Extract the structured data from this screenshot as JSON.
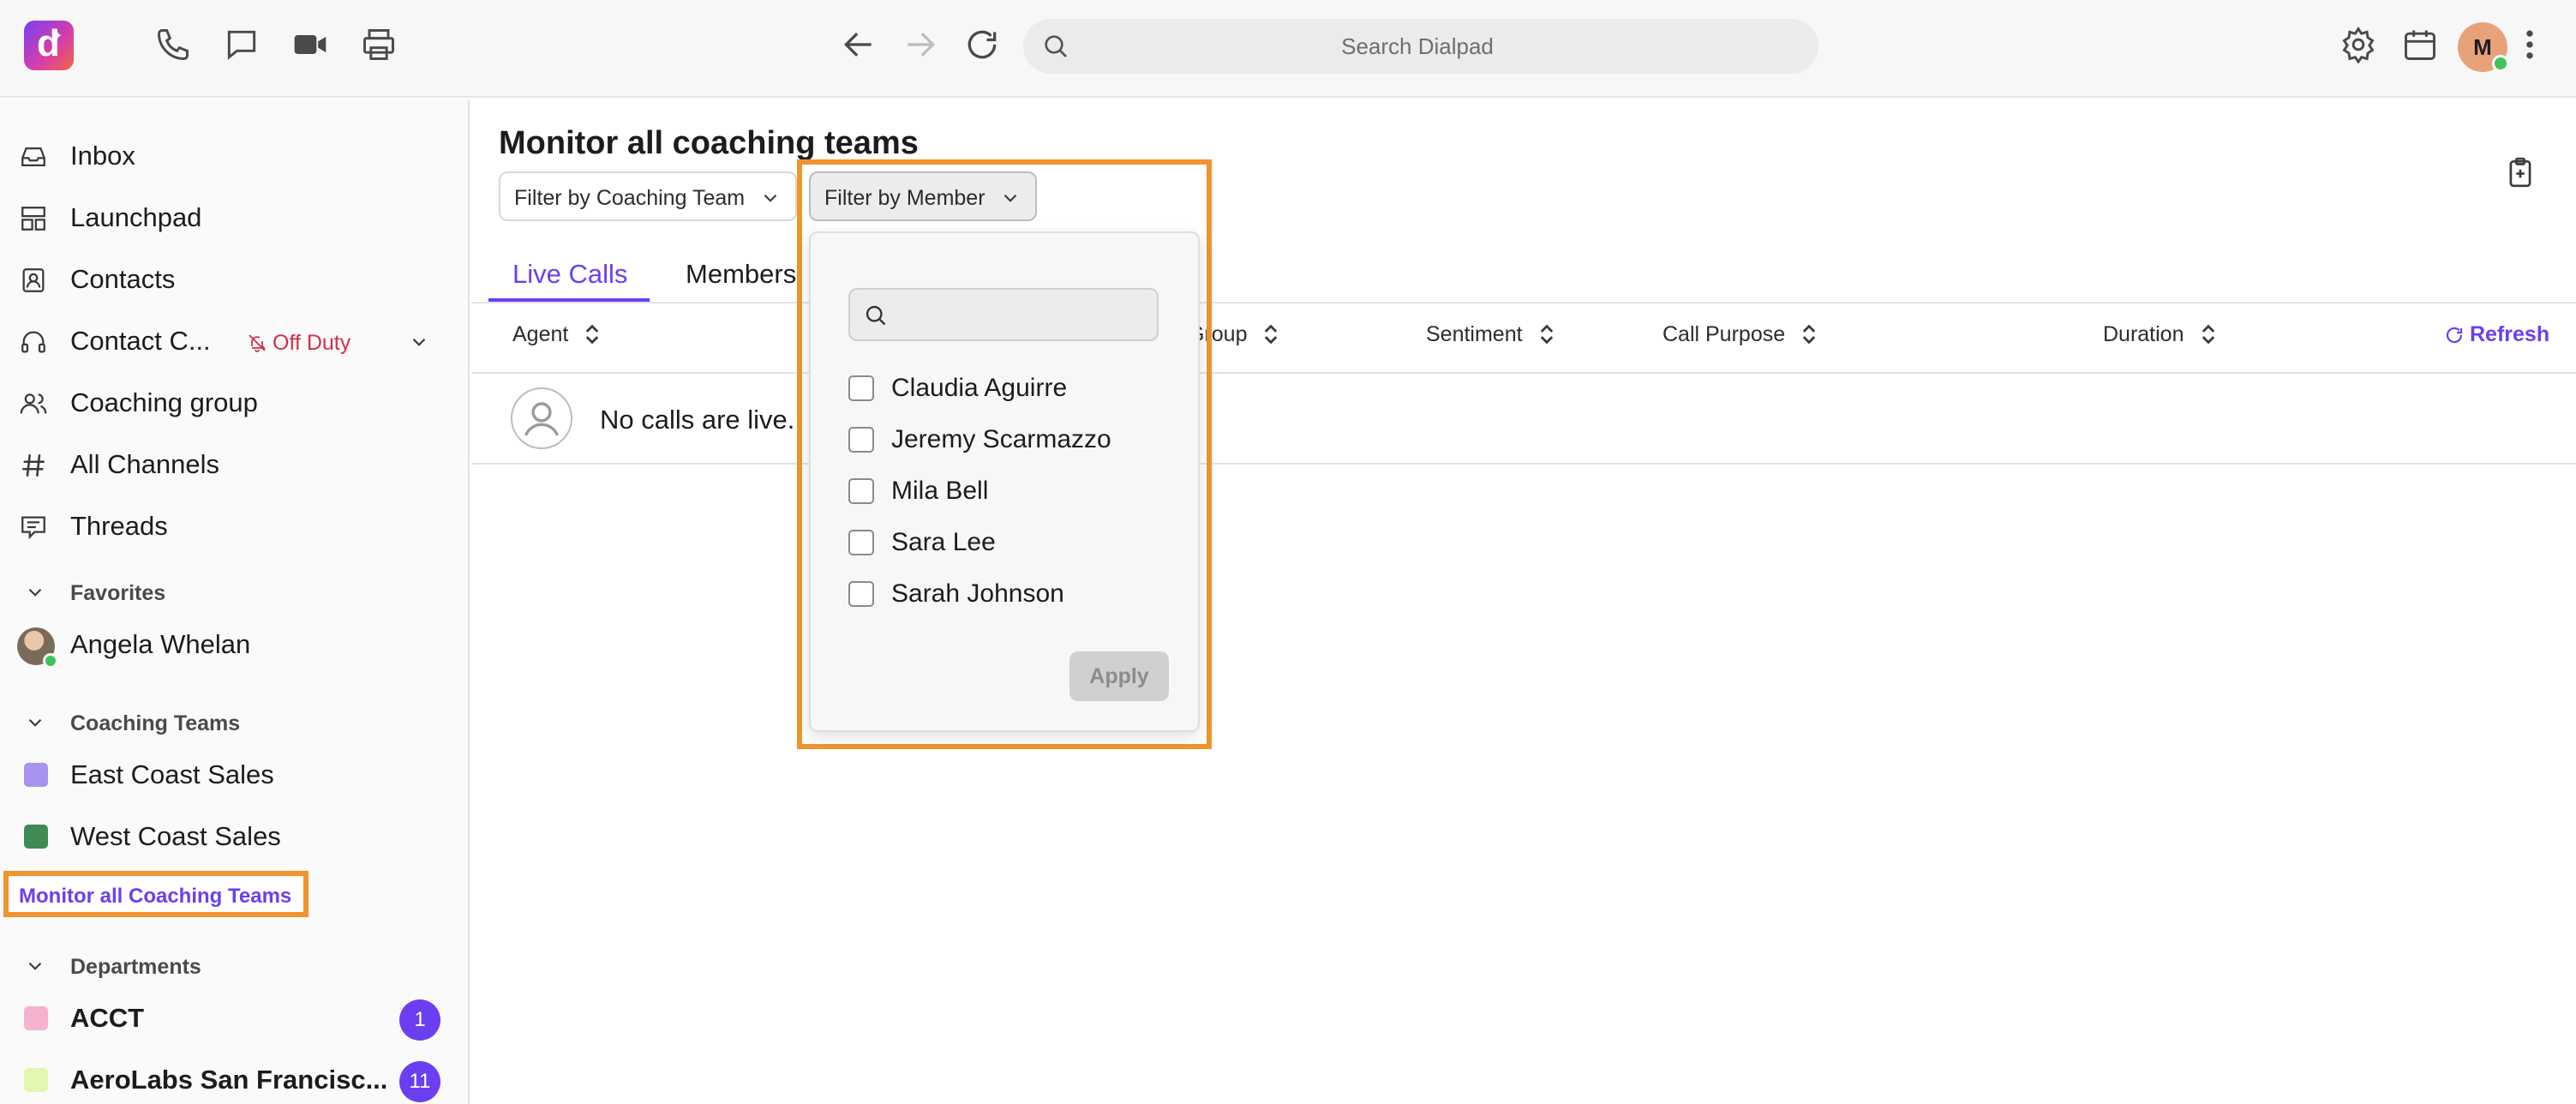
{
  "topbar": {
    "logo_letter": "d",
    "search_placeholder": "Search Dialpad",
    "avatar_initial": "M"
  },
  "sidebar": {
    "items": [
      {
        "label": "Inbox",
        "icon": "inbox-icon"
      },
      {
        "label": "Launchpad",
        "icon": "launchpad-icon"
      },
      {
        "label": "Contacts",
        "icon": "contacts-icon"
      },
      {
        "label": "Contact C...",
        "icon": "headset-icon",
        "status": "Off Duty"
      },
      {
        "label": "Coaching group",
        "icon": "people-icon"
      },
      {
        "label": "All Channels",
        "icon": "hash-icon"
      },
      {
        "label": "Threads",
        "icon": "threads-icon"
      }
    ],
    "favorites": {
      "header": "Favorites",
      "items": [
        {
          "label": "Angela Whelan"
        }
      ]
    },
    "coaching_teams": {
      "header": "Coaching Teams",
      "items": [
        {
          "label": "East Coast Sales",
          "color": "#a993f0"
        },
        {
          "label": "West Coast Sales",
          "color": "#3f8a55"
        }
      ],
      "monitor_link": "Monitor all Coaching Teams"
    },
    "departments": {
      "header": "Departments",
      "items": [
        {
          "label": "ACCT",
          "color": "#f5b3cf",
          "badge": "1"
        },
        {
          "label": "AeroLabs San Francisc...",
          "color": "#e3f7b0",
          "badge": "11"
        }
      ]
    }
  },
  "main": {
    "title": "Monitor all coaching teams",
    "filter_team_label": "Filter by Coaching Team",
    "filter_member_label": "Filter by Member",
    "tabs": [
      {
        "label": "Live Calls",
        "active": true
      },
      {
        "label": "Members",
        "active": false
      }
    ],
    "table": {
      "headers": [
        "Agent",
        "Group",
        "Sentiment",
        "Call Purpose",
        "Duration"
      ],
      "refresh_label": "Refresh",
      "empty_message": "No calls are live."
    }
  },
  "dropdown": {
    "search_value": "",
    "members": [
      "Claudia Aguirre",
      "Jeremy Scarmazzo",
      "Mila Bell",
      "Sara Lee",
      "Sarah Johnson"
    ],
    "apply_label": "Apply"
  },
  "colors": {
    "accent": "#6b3ff0",
    "highlight": "#f0942b",
    "off_duty": "#d3304a"
  }
}
